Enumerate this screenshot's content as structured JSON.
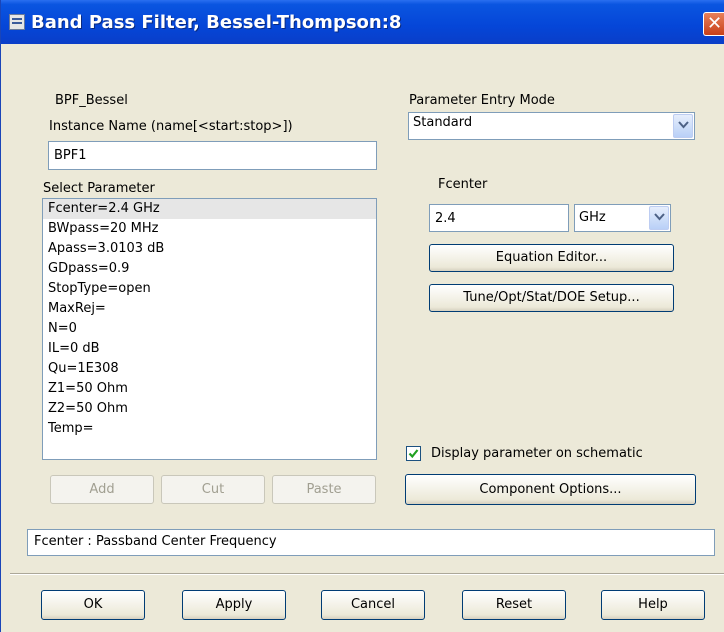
{
  "window": {
    "title": "Band Pass Filter, Bessel-Thompson:8",
    "close_glyph": "✕"
  },
  "component": {
    "name": "BPF_Bessel"
  },
  "instance": {
    "label": "Instance Name  (name[<start:stop>])",
    "value": "BPF1"
  },
  "select_parameter": {
    "label": "Select Parameter",
    "items": [
      "Fcenter=2.4 GHz",
      "BWpass=20 MHz",
      "Apass=3.0103 dB",
      "GDpass=0.9",
      "StopType=open",
      "MaxRej=",
      "N=0",
      "IL=0 dB",
      "Qu=1E308",
      "Z1=50 Ohm",
      "Z2=50 Ohm",
      "Temp="
    ],
    "selected_index": 0
  },
  "list_buttons": {
    "add": "Add",
    "cut": "Cut",
    "paste": "Paste"
  },
  "entry_mode": {
    "label": "Parameter Entry Mode",
    "value": "Standard"
  },
  "parameter": {
    "name": "Fcenter",
    "value": "2.4",
    "unit": "GHz"
  },
  "buttons": {
    "equation_editor": "Equation Editor...",
    "tune_setup": "Tune/Opt/Stat/DOE Setup...",
    "component_options": "Component Options..."
  },
  "display_checkbox": {
    "label": "Display parameter on schematic",
    "checked": true
  },
  "status": "Fcenter : Passband Center Frequency",
  "footer": {
    "ok": "OK",
    "apply": "Apply",
    "cancel": "Cancel",
    "reset": "Reset",
    "help": "Help"
  },
  "colors": {
    "titlebar": "#0546d8",
    "face": "#ece9d8",
    "border": "#7f9db9",
    "button_border": "#003c74"
  }
}
